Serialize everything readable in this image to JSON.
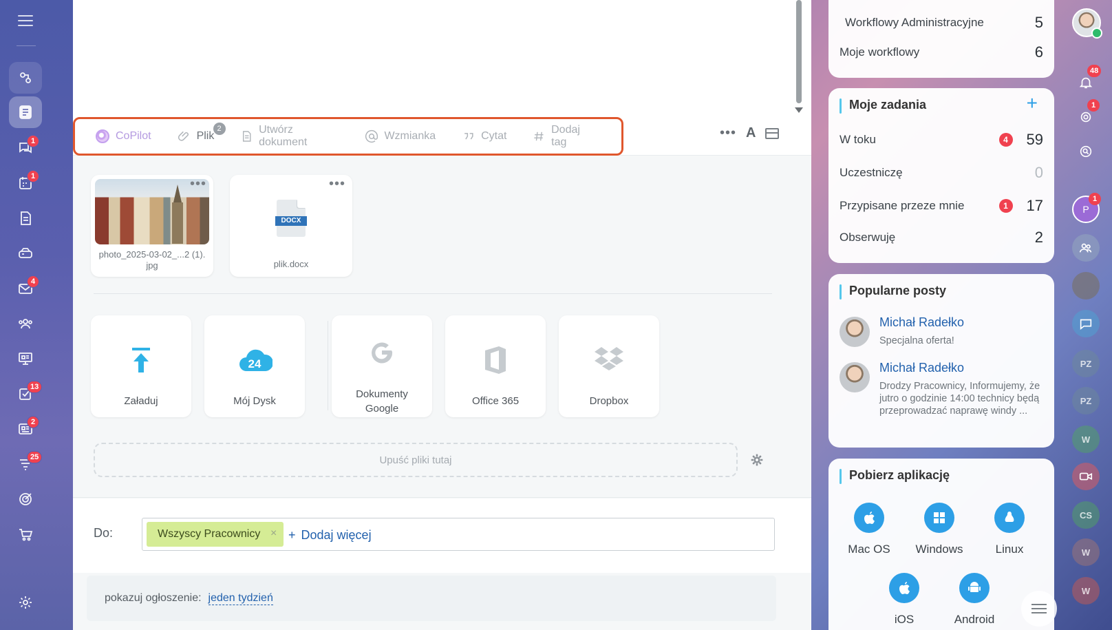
{
  "toolbar": {
    "copilot": "CoPilot",
    "file": "Plik",
    "file_count": "2",
    "create_doc": "Utwórz dokument",
    "mention": "Wzmianka",
    "quote": "Cytat",
    "add_tag": "Dodaj tag",
    "more": "•••",
    "font": "A"
  },
  "attachments": [
    {
      "name_line1": "photo_2025-03-02_...2 (1).",
      "name_line2": "jpg"
    },
    {
      "badge": "DOCX",
      "name": "plik.docx"
    }
  ],
  "sources": [
    {
      "label": "Załaduj"
    },
    {
      "label": "Mój Dysk",
      "icon_text": "24"
    },
    {
      "label_line1": "Dokumenty",
      "label_line2": "Google"
    },
    {
      "label": "Office 365"
    },
    {
      "label": "Dropbox"
    }
  ],
  "dropzone": "Upuść pliki tutaj",
  "recipients": {
    "label": "Do:",
    "chip": "Wszyscy Pracownicy",
    "chip_remove": "×",
    "add_more": "Dodaj więcej",
    "plus": "+"
  },
  "announcement": {
    "label": "pokazuj ogłoszenie:",
    "value": "jeden tydzień"
  },
  "workflows": {
    "rows": [
      {
        "label": "Workflowy Administracyjne",
        "count": "5"
      },
      {
        "label": "Moje workflowy",
        "count": "6"
      }
    ]
  },
  "tasks": {
    "title": "Moje zadania",
    "add": "+",
    "rows": [
      {
        "label": "W toku",
        "badge": "4",
        "count": "59"
      },
      {
        "label": "Uczestniczę",
        "count": "0"
      },
      {
        "label": "Przypisane przeze mnie",
        "badge": "1",
        "count": "17"
      },
      {
        "label": "Obserwuję",
        "count": "2"
      }
    ]
  },
  "popular": {
    "title": "Popularne posty",
    "posts": [
      {
        "author": "Michał Radełko",
        "text": "Specjalna oferta!"
      },
      {
        "author": "Michał Radełko",
        "text": "Drodzy Pracownicy, Informujemy, że jutro o godzinie 14:00 technicy będą przeprowadzać naprawę windy ..."
      }
    ]
  },
  "apps": {
    "title": "Pobierz aplikację",
    "items": [
      "Mac OS",
      "Windows",
      "Linux",
      "iOS",
      "Android"
    ]
  },
  "left_rail": {
    "badges": {
      "chat": "1",
      "calendar": "1",
      "mail": "4",
      "tasks": "13",
      "feed": "2",
      "crm": "25"
    }
  },
  "right_rail": {
    "notifications": "48",
    "copilot_badge": "1",
    "p_initial": "P",
    "p_badge": "1",
    "initials": [
      "PZ",
      "PZ",
      "W",
      "CS",
      "W",
      "W"
    ]
  }
}
